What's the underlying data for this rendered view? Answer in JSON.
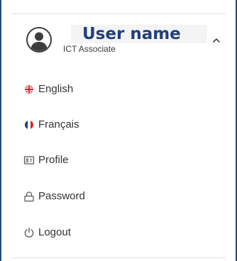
{
  "user": {
    "name": "User name",
    "role": "ICT Associate"
  },
  "menu": {
    "items": [
      {
        "label": "English",
        "icon": "uk-flag-icon"
      },
      {
        "label": "Français",
        "icon": "france-flag-icon"
      },
      {
        "label": "Profile",
        "icon": "id-card-icon"
      },
      {
        "label": "Password",
        "icon": "lock-icon"
      },
      {
        "label": "Logout",
        "icon": "power-icon"
      }
    ]
  },
  "colors": {
    "frame_border": "#1f4d82",
    "user_name_text": "#1f3f7a",
    "menu_text": "#333333",
    "flag_blue": "#1f3c8f",
    "flag_red": "#d62828"
  }
}
